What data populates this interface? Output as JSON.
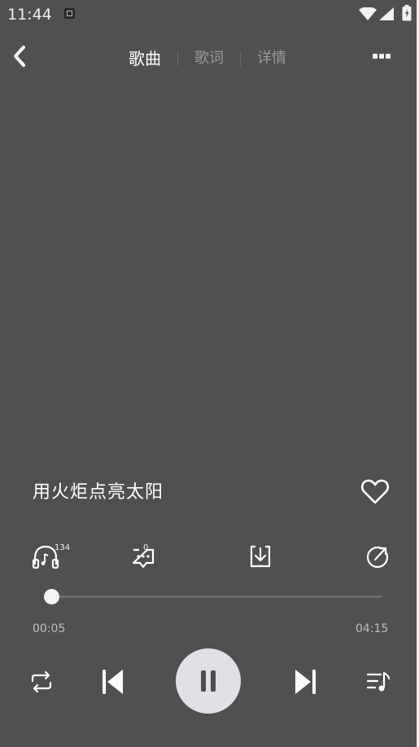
{
  "status_bar": {
    "time": "11:44"
  },
  "tabs": [
    {
      "label": "歌曲",
      "active": true
    },
    {
      "label": "歌词",
      "active": false
    },
    {
      "label": "详情",
      "active": false
    }
  ],
  "song": {
    "title": "用火炬点亮太阳",
    "favorited": false
  },
  "actions": {
    "listen_count": "134",
    "comment_count": "0"
  },
  "progress": {
    "current": "00:05",
    "total": "04:15",
    "fraction": 0.02
  },
  "player": {
    "state": "playing"
  },
  "icons": {
    "back": "back-chevron-icon",
    "more": "more-dots-icon",
    "heart": "heart-outline-icon",
    "headphones": "headphones-icon",
    "comment": "comment-icon",
    "download": "download-icon",
    "share": "share-icon",
    "repeat": "repeat-icon",
    "prev": "skip-previous-icon",
    "pause": "pause-icon",
    "next": "skip-next-icon",
    "playlist": "playlist-icon"
  },
  "colors": {
    "background": "#505050",
    "active_tab": "#ffffff",
    "inactive_tab": "#9a9a9a",
    "play_button": "#e3dfe6"
  }
}
